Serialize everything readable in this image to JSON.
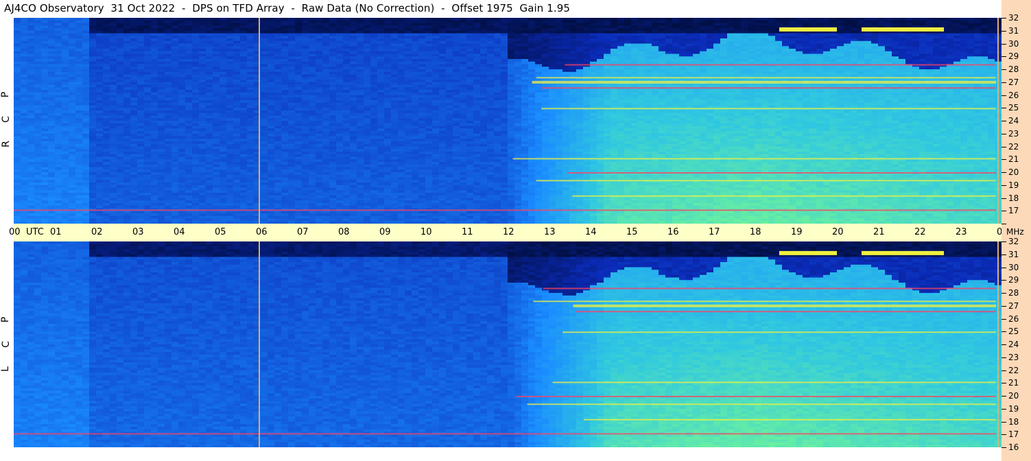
{
  "header": {
    "title": "AJ4CO Observatory  31 Oct 2022  -  DPS on TFD Array  -  Raw Data (No Correction)  -  Offset 1975  Gain 1.95"
  },
  "panels": {
    "top_label": [
      "R",
      "C",
      "P"
    ],
    "bottom_label": [
      "L",
      "C",
      "P"
    ]
  },
  "axis": {
    "utc_label": "UTC",
    "mhz_label": "MHz"
  },
  "colors": {
    "axis_time_bg": "#ffffc8",
    "axis_freq_bg": "#fcd9b8",
    "marker_line": "#d8b070",
    "low": "#0a2bb8",
    "mid": "#1a8cff",
    "high": "#6af0a0",
    "hot": "#f0f040",
    "rfi": "#ff4060"
  },
  "chart_data": {
    "type": "heatmap",
    "title": "AJ4CO Observatory  31 Oct 2022  -  DPS on TFD Array  -  Raw Data (No Correction)  -  Offset 1975  Gain 1.95",
    "xlabel": "UTC",
    "ylabel": "MHz",
    "x_ticks": [
      "00",
      "01",
      "02",
      "03",
      "04",
      "05",
      "06",
      "07",
      "08",
      "09",
      "10",
      "11",
      "12",
      "13",
      "14",
      "15",
      "16",
      "17",
      "18",
      "19",
      "20",
      "21",
      "22",
      "23",
      "00"
    ],
    "y_ticks": [
      16,
      17,
      18,
      19,
      20,
      21,
      22,
      23,
      24,
      25,
      26,
      27,
      28,
      29,
      30,
      31,
      32
    ],
    "xlim": [
      0,
      24
    ],
    "ylim": [
      16,
      32
    ],
    "panels": [
      "RCP",
      "LCP"
    ],
    "marker_times": [
      5.95,
      23.9
    ]
  }
}
